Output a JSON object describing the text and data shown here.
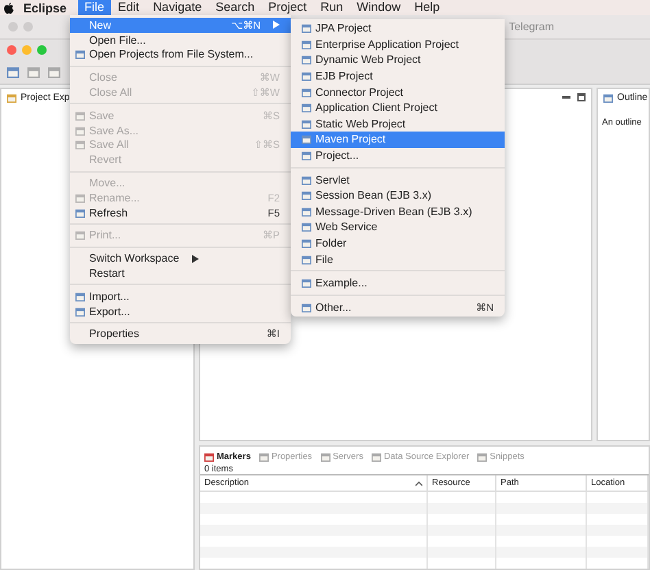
{
  "menu_bar": {
    "app_name": "Eclipse",
    "items": [
      {
        "label": "File",
        "selected": true
      },
      {
        "label": "Edit",
        "selected": false
      },
      {
        "label": "Navigate",
        "selected": false
      },
      {
        "label": "Search",
        "selected": false
      },
      {
        "label": "Project",
        "selected": false
      },
      {
        "label": "Run",
        "selected": false
      },
      {
        "label": "Window",
        "selected": false
      },
      {
        "label": "Help",
        "selected": false
      }
    ]
  },
  "background_window": {
    "title": "Telegram"
  },
  "project_explorer": {
    "tab": "Project Exp"
  },
  "outline": {
    "tab": "Outline",
    "message": "An outline"
  },
  "markers_panel": {
    "tabs": [
      {
        "label": "Markers",
        "selected": true
      },
      {
        "label": "Properties",
        "selected": false
      },
      {
        "label": "Servers",
        "selected": false
      },
      {
        "label": "Data Source Explorer",
        "selected": false
      },
      {
        "label": "Snippets",
        "selected": false
      }
    ],
    "count": "0 items",
    "columns": [
      "Description",
      "Resource",
      "Path",
      "Location"
    ]
  },
  "file_menu": {
    "items": [
      {
        "kind": "item",
        "label": "New",
        "shortcut": "⌥⌘N",
        "submenu": true,
        "icon": false,
        "disabled": false,
        "selected": true
      },
      {
        "kind": "item",
        "label": "Open File...",
        "icon": false,
        "submenu": false,
        "disabled": false,
        "selected": false
      },
      {
        "kind": "item",
        "label": "Open Projects from File System...",
        "icon": true,
        "submenu": false,
        "disabled": false,
        "selected": false
      },
      {
        "kind": "separator"
      },
      {
        "kind": "item",
        "label": "Close",
        "shortcut": "⌘W",
        "icon": false,
        "submenu": false,
        "disabled": true,
        "selected": false
      },
      {
        "kind": "item",
        "label": "Close All",
        "shortcut": "⇧⌘W",
        "icon": false,
        "submenu": false,
        "disabled": true,
        "selected": false
      },
      {
        "kind": "separator"
      },
      {
        "kind": "item",
        "label": "Save",
        "shortcut": "⌘S",
        "icon": true,
        "submenu": false,
        "disabled": true,
        "selected": false
      },
      {
        "kind": "item",
        "label": "Save As...",
        "icon": true,
        "submenu": false,
        "disabled": true,
        "selected": false
      },
      {
        "kind": "item",
        "label": "Save All",
        "shortcut": "⇧⌘S",
        "icon": true,
        "submenu": false,
        "disabled": true,
        "selected": false
      },
      {
        "kind": "item",
        "label": "Revert",
        "icon": false,
        "submenu": false,
        "disabled": true,
        "selected": false
      },
      {
        "kind": "separator"
      },
      {
        "kind": "item",
        "label": "Move...",
        "icon": false,
        "submenu": false,
        "disabled": true,
        "selected": false
      },
      {
        "kind": "item",
        "label": "Rename...",
        "shortcut": "F2",
        "icon": true,
        "submenu": false,
        "disabled": true,
        "selected": false
      },
      {
        "kind": "item",
        "label": "Refresh",
        "shortcut": "F5",
        "icon": true,
        "submenu": false,
        "disabled": false,
        "selected": false
      },
      {
        "kind": "separator"
      },
      {
        "kind": "item",
        "label": "Print...",
        "shortcut": "⌘P",
        "icon": true,
        "submenu": false,
        "disabled": true,
        "selected": false
      },
      {
        "kind": "separator"
      },
      {
        "kind": "item",
        "label": "Switch Workspace",
        "icon": false,
        "submenu": true,
        "disabled": false,
        "selected": false
      },
      {
        "kind": "item",
        "label": "Restart",
        "icon": false,
        "submenu": false,
        "disabled": false,
        "selected": false
      },
      {
        "kind": "separator"
      },
      {
        "kind": "item",
        "label": "Import...",
        "icon": true,
        "submenu": false,
        "disabled": false,
        "selected": false
      },
      {
        "kind": "item",
        "label": "Export...",
        "icon": true,
        "submenu": false,
        "disabled": false,
        "selected": false
      },
      {
        "kind": "separator"
      },
      {
        "kind": "item",
        "label": "Properties",
        "shortcut": "⌘I",
        "icon": false,
        "submenu": false,
        "disabled": false,
        "selected": false
      }
    ]
  },
  "new_submenu": {
    "items": [
      {
        "kind": "item",
        "label": "JPA Project",
        "icon": true,
        "selected": false
      },
      {
        "kind": "item",
        "label": "Enterprise Application Project",
        "icon": true,
        "selected": false
      },
      {
        "kind": "item",
        "label": "Dynamic Web Project",
        "icon": true,
        "selected": false
      },
      {
        "kind": "item",
        "label": "EJB Project",
        "icon": true,
        "selected": false
      },
      {
        "kind": "item",
        "label": "Connector Project",
        "icon": true,
        "selected": false
      },
      {
        "kind": "item",
        "label": "Application Client Project",
        "icon": true,
        "selected": false
      },
      {
        "kind": "item",
        "label": "Static Web Project",
        "icon": true,
        "selected": false
      },
      {
        "kind": "item",
        "label": "Maven Project",
        "icon": true,
        "selected": true
      },
      {
        "kind": "item",
        "label": "Project...",
        "icon": true,
        "selected": false
      },
      {
        "kind": "separator"
      },
      {
        "kind": "item",
        "label": "Servlet",
        "icon": true,
        "selected": false
      },
      {
        "kind": "item",
        "label": "Session Bean (EJB 3.x)",
        "icon": true,
        "selected": false
      },
      {
        "kind": "item",
        "label": "Message-Driven Bean (EJB 3.x)",
        "icon": true,
        "selected": false
      },
      {
        "kind": "item",
        "label": "Web Service",
        "icon": true,
        "selected": false
      },
      {
        "kind": "item",
        "label": "Folder",
        "icon": true,
        "selected": false
      },
      {
        "kind": "item",
        "label": "File",
        "icon": true,
        "selected": false
      },
      {
        "kind": "separator"
      },
      {
        "kind": "item",
        "label": "Example...",
        "icon": true,
        "selected": false
      },
      {
        "kind": "separator"
      },
      {
        "kind": "item",
        "label": "Other...",
        "shortcut": "⌘N",
        "icon": true,
        "selected": false
      }
    ]
  }
}
